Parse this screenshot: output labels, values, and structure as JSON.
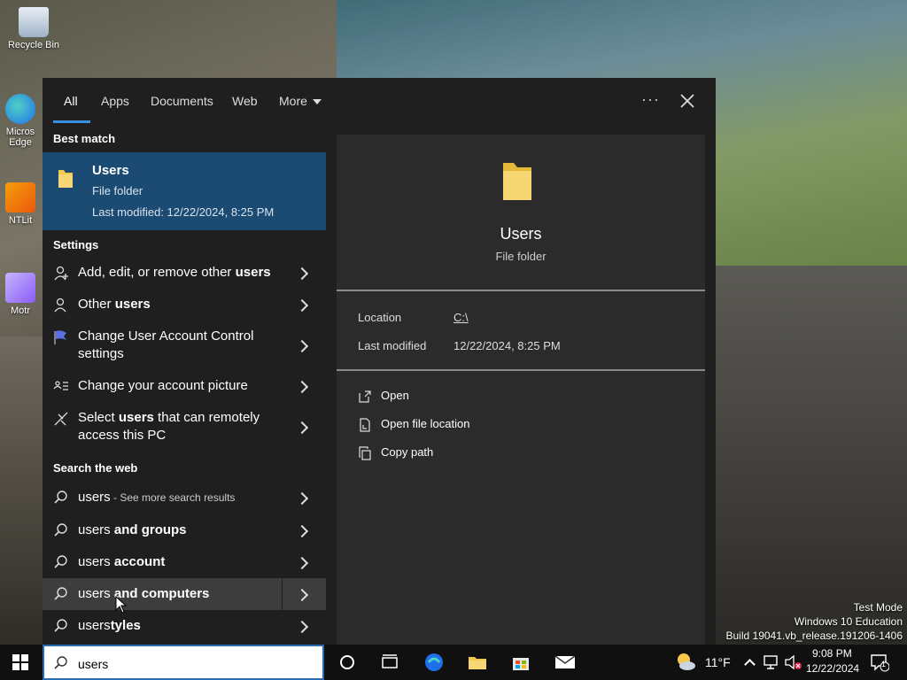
{
  "desktop": {
    "icons": [
      {
        "label": "Recycle Bin"
      },
      {
        "label": "Micros Edge"
      },
      {
        "label": "NTLit"
      },
      {
        "label": "Motr"
      }
    ],
    "watermark": {
      "line1": "Test Mode",
      "line2": "Windows 10 Education",
      "line3": "Build 19041.vb_release.191206-1406"
    }
  },
  "search": {
    "tabs": [
      {
        "label": "All",
        "active": true
      },
      {
        "label": "Apps"
      },
      {
        "label": "Documents"
      },
      {
        "label": "Web"
      },
      {
        "label": "More"
      }
    ],
    "ellipsis": "···",
    "best_match": {
      "heading": "Best match",
      "title": "Users",
      "subtitle": "File folder",
      "modified": "Last modified: 12/22/2024, 8:25 PM"
    },
    "settings": {
      "heading": "Settings",
      "items": [
        {
          "pre": "Add, edit, or remove other ",
          "bold": "users",
          "post": "",
          "icon": "person-icon"
        },
        {
          "pre": "Other ",
          "bold": "users",
          "post": "",
          "icon": "person-icon"
        },
        {
          "pre": "Change User Account Control settings",
          "bold": "",
          "post": "",
          "icon": "uac-flag-icon"
        },
        {
          "pre": "Change your account picture",
          "bold": "",
          "post": "",
          "icon": "account-card-icon"
        },
        {
          "pre": "Select ",
          "bold": "users",
          "post": " that can remotely access this PC",
          "icon": "remote-icon"
        }
      ]
    },
    "web": {
      "heading": "Search the web",
      "items": [
        {
          "pre": "users",
          "bold": "",
          "post": " - See more search results"
        },
        {
          "pre": "users ",
          "bold": "and groups",
          "post": ""
        },
        {
          "pre": "users ",
          "bold": "account",
          "post": ""
        },
        {
          "pre": "users ",
          "bold": "and computers",
          "post": ""
        },
        {
          "pre": "users",
          "bold": "tyles",
          "post": ""
        }
      ]
    },
    "preview": {
      "title": "Users",
      "subtitle": "File folder",
      "location_label": "Location",
      "location_value": "C:\\",
      "modified_label": "Last modified",
      "modified_value": "12/22/2024, 8:25 PM",
      "actions": [
        {
          "label": "Open"
        },
        {
          "label": "Open file location"
        },
        {
          "label": "Copy path"
        }
      ]
    }
  },
  "taskbar": {
    "search_value": "users",
    "weather": "11°F",
    "time": "9:08 PM",
    "date": "12/22/2024",
    "notification_count": "1"
  },
  "colors": {
    "panel": "#1f1f1f",
    "selected": "#1b4b73",
    "accent": "#3a8fde",
    "folder": "#f2c94c"
  }
}
